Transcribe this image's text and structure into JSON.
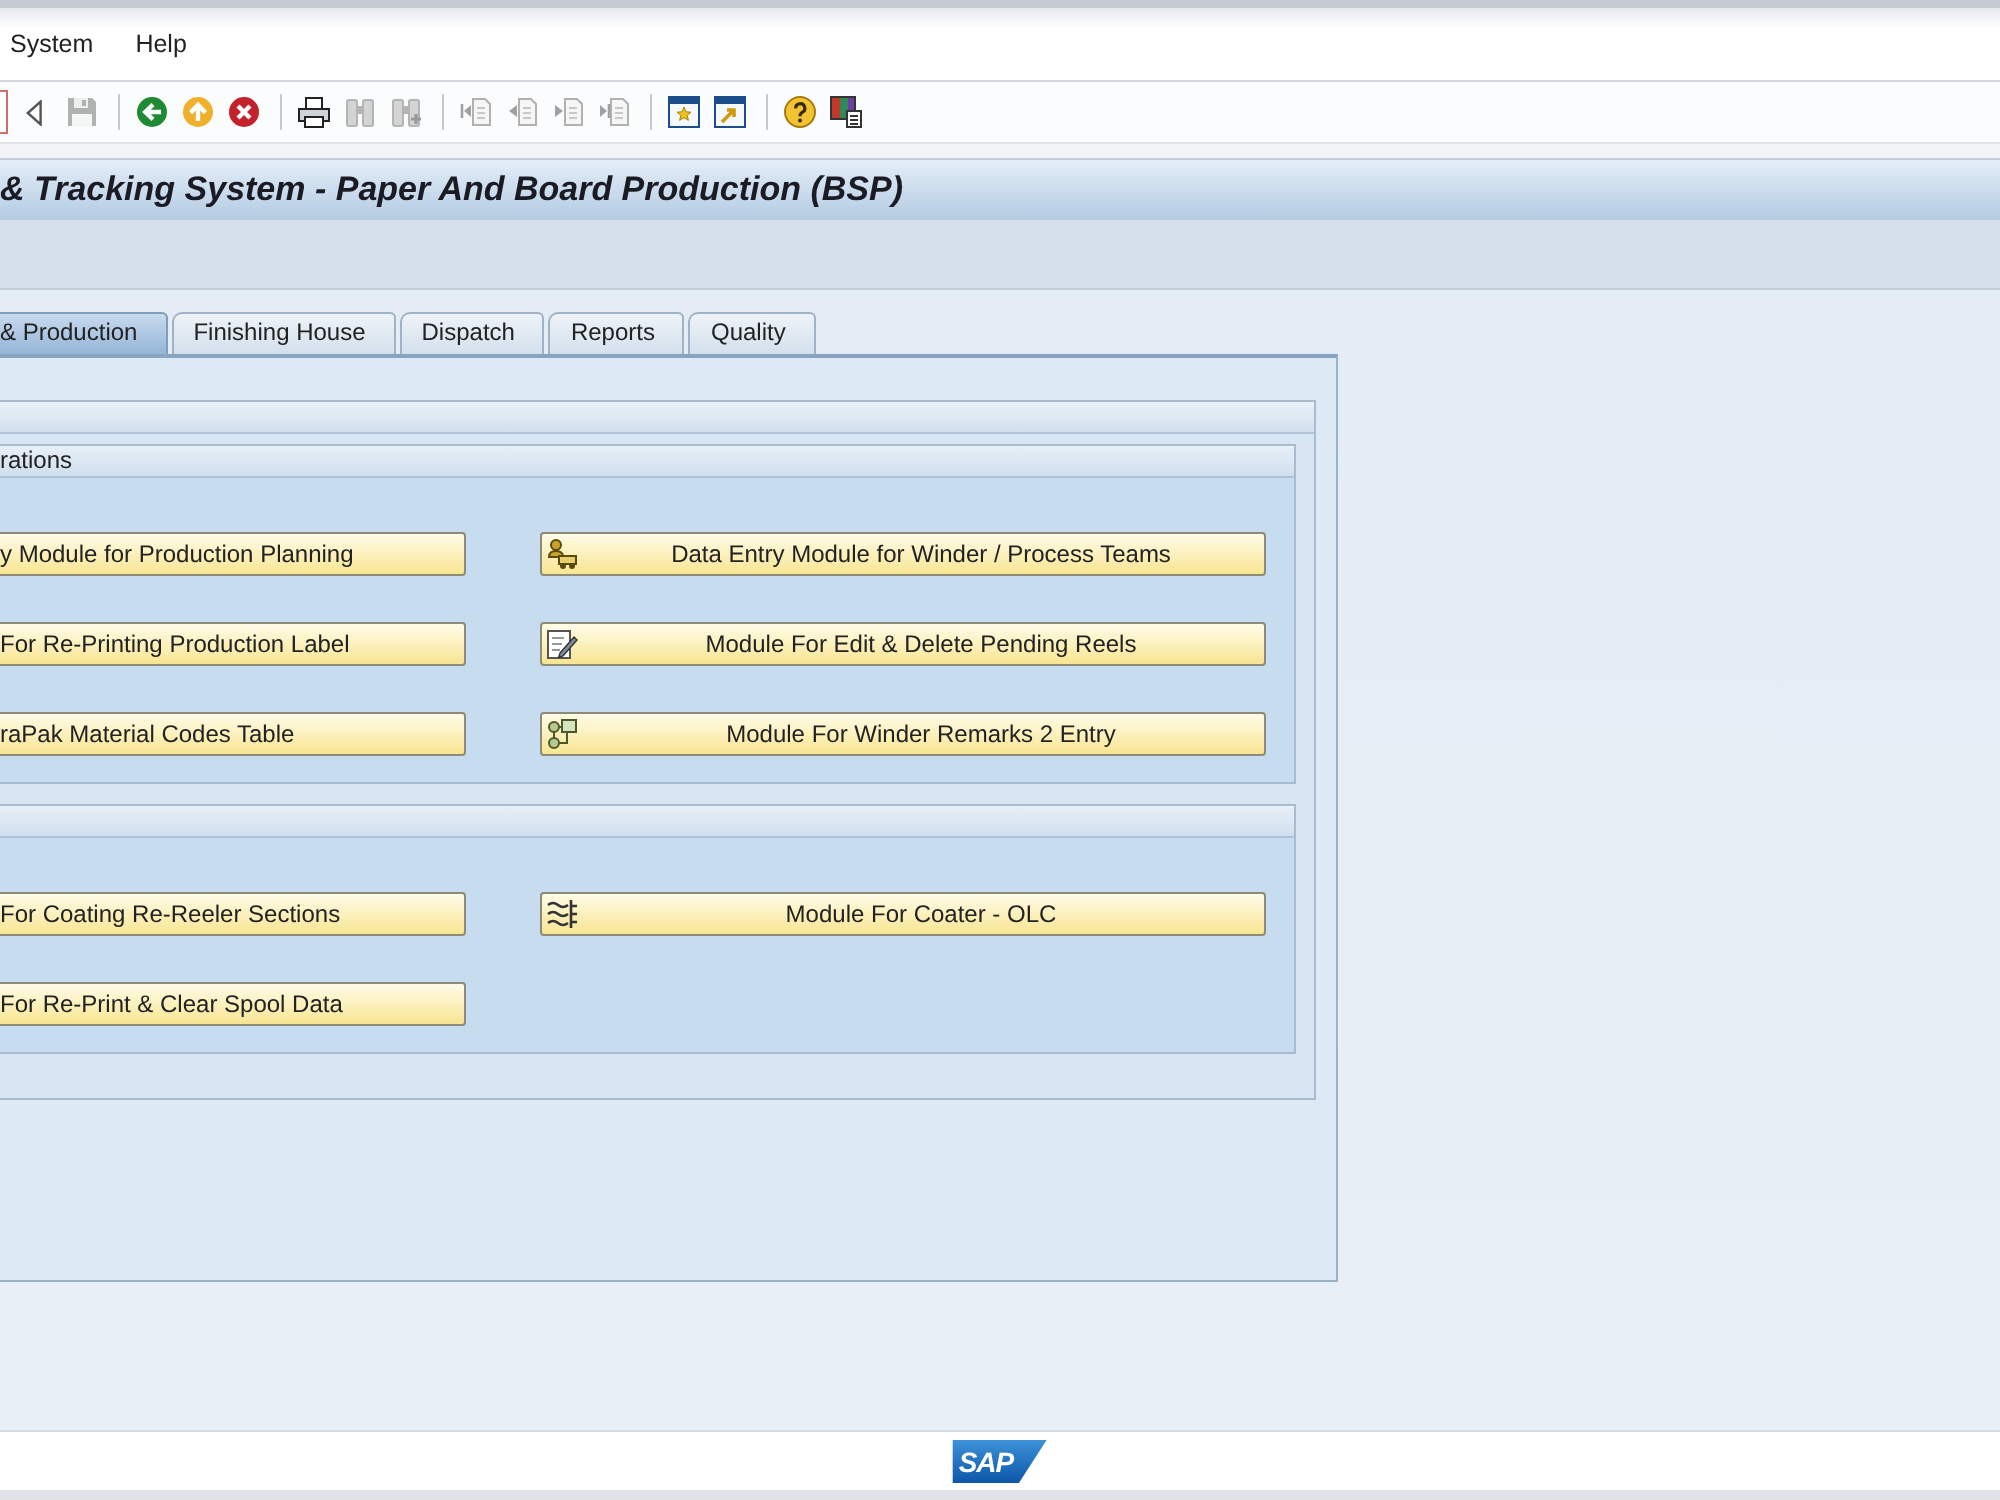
{
  "menu_bar": {
    "items": [
      "System",
      "Help"
    ]
  },
  "toolbar": {
    "groups": [
      [
        {
          "disabled": false
        },
        {
          "disabled": true
        }
      ],
      [
        {
          "disabled": false
        },
        {
          "disabled": false
        },
        {
          "disabled": false
        }
      ],
      [
        {
          "disabled": false
        },
        {
          "disabled": true
        },
        {
          "disabled": true
        }
      ],
      [
        {
          "disabled": true
        },
        {
          "disabled": true
        },
        {
          "disabled": true
        },
        {
          "disabled": true
        }
      ],
      [
        {
          "disabled": false
        },
        {
          "disabled": false
        }
      ],
      [
        {
          "disabled": false
        },
        {
          "disabled": false
        }
      ]
    ]
  },
  "title_bar": {
    "title": "& Tracking System - Paper And Board Production (BSP)"
  },
  "tabs": [
    {
      "label": "& Production",
      "selected": true
    },
    {
      "label": "Finishing House",
      "selected": false
    },
    {
      "label": "Dispatch",
      "selected": false
    },
    {
      "label": "Reports",
      "selected": false
    },
    {
      "label": "Quality",
      "selected": false
    }
  ],
  "tab_panel": {
    "groups": [
      {
        "title": "rations",
        "rows": [
          [
            "y Module for Production Planning",
            "Data Entry Module for Winder / Process Teams"
          ],
          [
            "For Re-Printing Production Label",
            "Module For Edit & Delete Pending Reels"
          ],
          [
            "raPak Material Codes Table",
            "Module For Winder Remarks 2 Entry"
          ]
        ]
      },
      {
        "rows": [
          [
            "For Coating Re-Reeler Sections",
            "Module For Coater - OLC"
          ],
          [
            "For Re-Print & Clear Spool Data"
          ]
        ]
      }
    ]
  },
  "status_bar": {
    "logo": "SAP"
  }
}
